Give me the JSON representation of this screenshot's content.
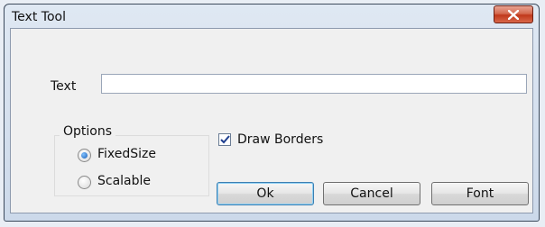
{
  "window": {
    "title": "Text Tool",
    "close_glyph": "X"
  },
  "text_field": {
    "label": "Text",
    "value": ""
  },
  "options": {
    "group_label": "Options",
    "radios": [
      {
        "label": "FixedSize",
        "checked": true
      },
      {
        "label": "Scalable",
        "checked": false
      }
    ]
  },
  "draw_borders": {
    "label": "Draw Borders",
    "checked": true
  },
  "buttons": {
    "ok": "Ok",
    "cancel": "Cancel",
    "font": "Font"
  },
  "colors": {
    "close_button": "#c0381b",
    "check_mark": "#1f3f8f",
    "radio_selected": "#1c5fb5"
  }
}
